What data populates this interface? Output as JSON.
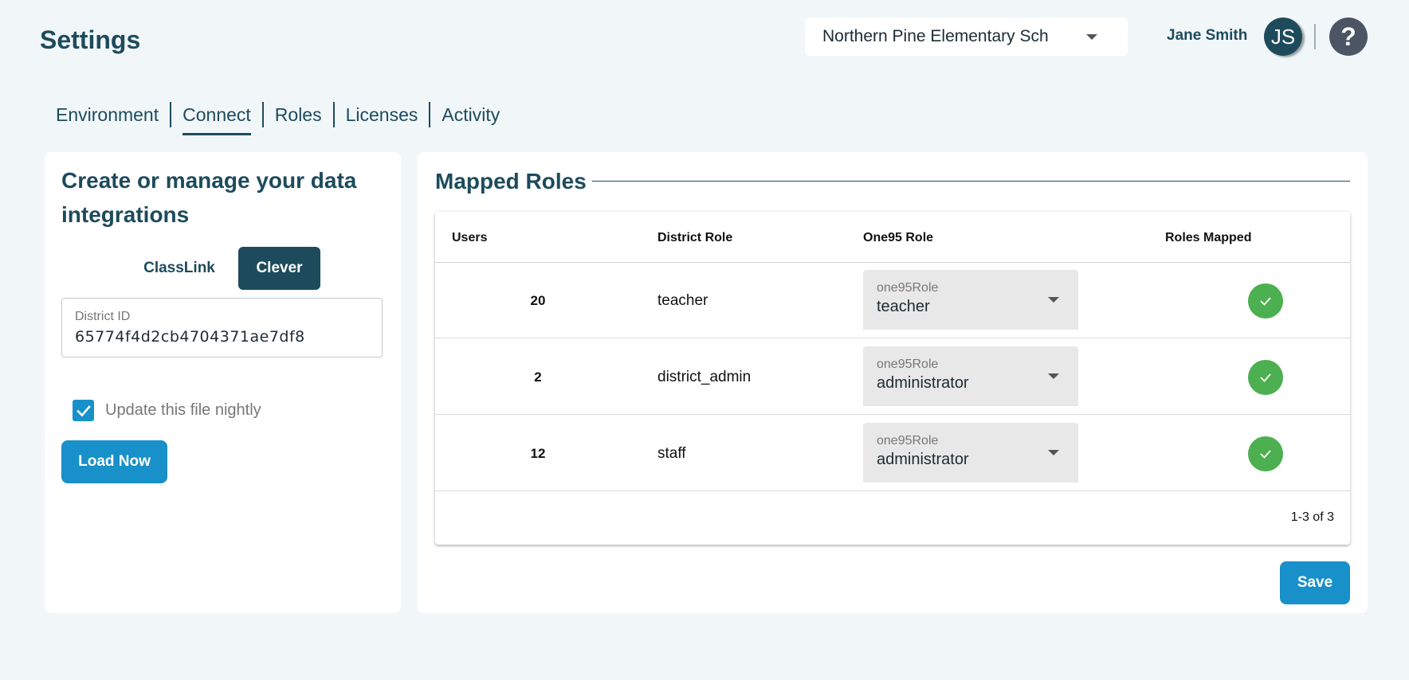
{
  "header": {
    "title": "Settings",
    "school_selected": "Northern Pine Elementary Sch",
    "user_name": "Jane Smith",
    "avatar_initials": "JS",
    "help_glyph": "?"
  },
  "tabs": [
    {
      "label": "Environment",
      "active": false
    },
    {
      "label": "Connect",
      "active": true
    },
    {
      "label": "Roles",
      "active": false
    },
    {
      "label": "Licenses",
      "active": false
    },
    {
      "label": "Activity",
      "active": false
    }
  ],
  "integrations": {
    "heading": "Create or manage your data integrations",
    "providers": [
      "ClassLink",
      "Clever"
    ],
    "selected_provider": "Clever",
    "district_id_label": "District ID",
    "district_id_value": "65774f4d2cb4704371ae7df8",
    "nightly_label": "Update this file nightly",
    "nightly_checked": true,
    "load_button": "Load Now"
  },
  "mapped_roles": {
    "title": "Mapped Roles",
    "columns": [
      "Users",
      "District Role",
      "One95 Role",
      "Roles Mapped"
    ],
    "select_label": "one95Role",
    "rows": [
      {
        "users": "20",
        "district_role": "teacher",
        "one95_role": "teacher",
        "mapped": true
      },
      {
        "users": "2",
        "district_role": "district_admin",
        "one95_role": "administrator",
        "mapped": true
      },
      {
        "users": "12",
        "district_role": "staff",
        "one95_role": "administrator",
        "mapped": true
      }
    ],
    "pagination": "1-3 of 3",
    "save_button": "Save"
  },
  "colors": {
    "primary_dark": "#1d4b5c",
    "accent_blue": "#1890c9",
    "success_green": "#4caf50",
    "background": "#f1f6f9"
  },
  "icons": {
    "dropdown": "chevron-down-icon",
    "checkbox": "checkmark-icon",
    "mapped": "check-circle-icon",
    "help": "help-icon"
  }
}
